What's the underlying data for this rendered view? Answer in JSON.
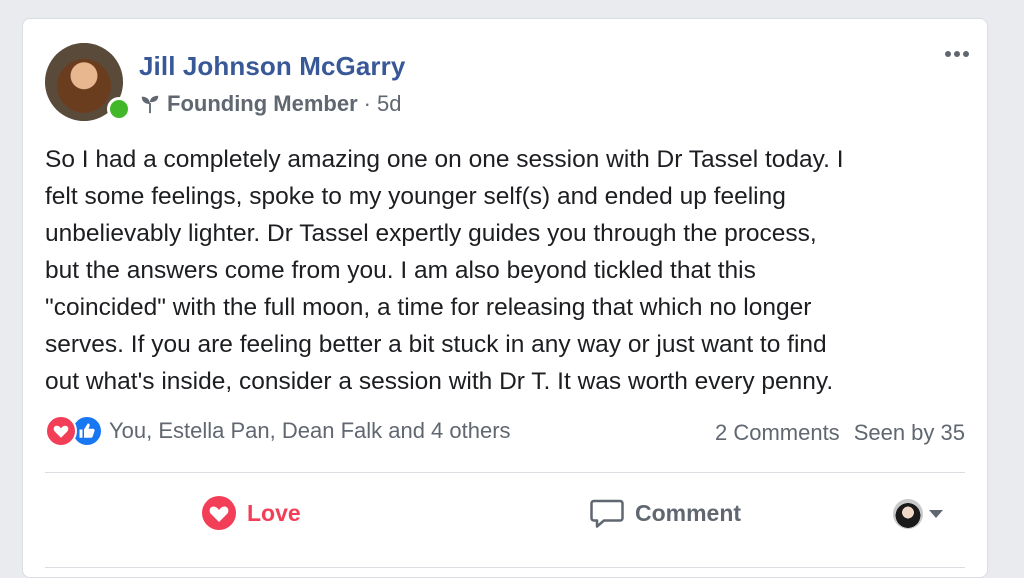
{
  "post": {
    "author": "Jill Johnson McGarry",
    "badge": "Founding Member",
    "separator": "·",
    "age": "5d",
    "text": "So I had a completely amazing one on one session with Dr Tassel today. I\nfelt some feelings, spoke to my younger self(s) and ended up feeling\nunbelievably lighter. Dr Tassel expertly guides you through the process,\nbut the answers come from you. I am also beyond tickled that this\n\"coincided\" with the full moon, a time for releasing that which no longer\nserves. If you are feeling better a bit stuck in any way or just want to find\nout what's inside, consider a session with Dr T. It was worth every penny."
  },
  "reactions": {
    "summary": "You, Estella Pan, Dean Falk and 4 others",
    "comments": "2 Comments",
    "seen": "Seen by 35"
  },
  "actions": {
    "love_label": "Love",
    "comment_label": "Comment"
  },
  "colors": {
    "name": "#385898",
    "love": "#f33e58",
    "like": "#1877f2",
    "online": "#42b72a"
  },
  "icons": [
    "more-icon",
    "sprout-icon",
    "love-reaction-icon",
    "like-reaction-icon",
    "heart-icon",
    "comment-icon",
    "chevron-down-icon"
  ]
}
